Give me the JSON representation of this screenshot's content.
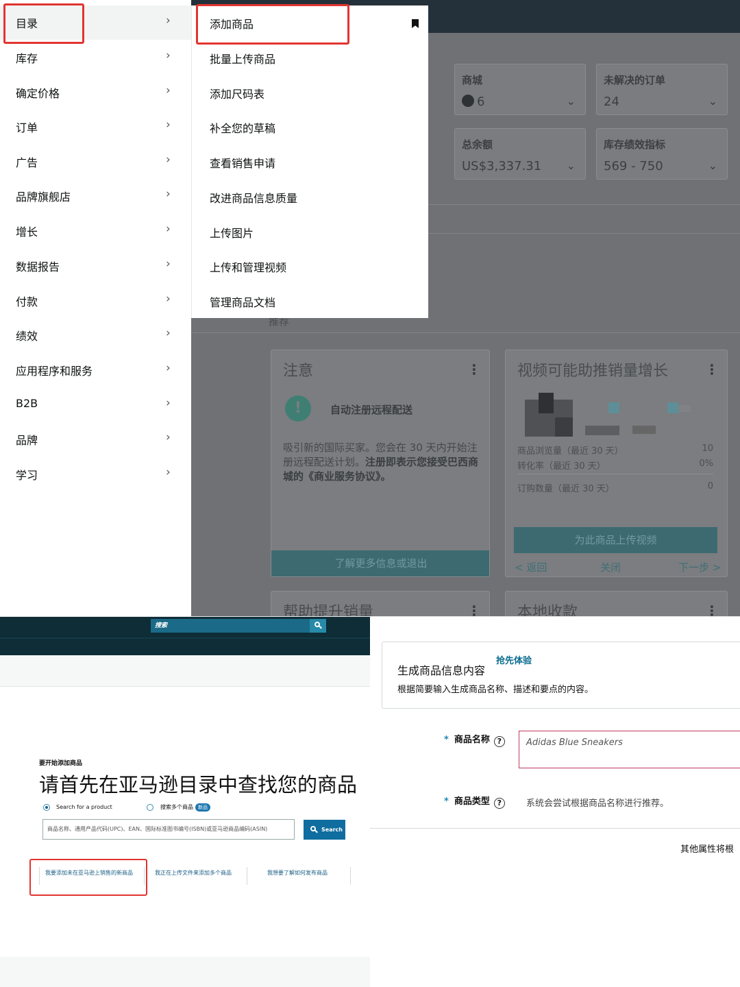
{
  "left_menu": {
    "items": [
      {
        "label": "目录"
      },
      {
        "label": "库存"
      },
      {
        "label": "确定价格"
      },
      {
        "label": "订单"
      },
      {
        "label": "广告"
      },
      {
        "label": "品牌旗舰店"
      },
      {
        "label": "增长"
      },
      {
        "label": "数据报告"
      },
      {
        "label": "付款"
      },
      {
        "label": "绩效"
      },
      {
        "label": "应用程序和服务"
      },
      {
        "label": "B2B"
      },
      {
        "label": "品牌"
      },
      {
        "label": "学习"
      }
    ]
  },
  "sub_menu": {
    "items": [
      {
        "label": "添加商品"
      },
      {
        "label": "批量上传商品"
      },
      {
        "label": "添加尺码表"
      },
      {
        "label": "补全您的草稿"
      },
      {
        "label": "查看销售申请"
      },
      {
        "label": "改进商品信息质量"
      },
      {
        "label": "上传图片"
      },
      {
        "label": "上传和管理视频"
      },
      {
        "label": "管理商品文档"
      }
    ]
  },
  "dashboard": {
    "metrics": [
      {
        "label": "商城",
        "value": "6"
      },
      {
        "label": "未解决的订单",
        "value": "24"
      },
      {
        "label": "总余额",
        "value": "US$3,337.31"
      },
      {
        "label": "库存绩效指标",
        "value": "569 - 750"
      }
    ],
    "section_label": "推荐",
    "notice_card": {
      "title": "注意",
      "heading": "自动注册远程配送",
      "body_1": "吸引新的国际买家。您会在 30 天内开始注册远程配送计划。",
      "body_bold": "注册即表示您接受巴西商城的《商业服务协议》。",
      "button": "了解更多信息或退出"
    },
    "video_card": {
      "title": "视频可能助推销量增长",
      "rows": [
        {
          "label": "商品浏览量（最近 30 天）",
          "value": "10"
        },
        {
          "label": "转化率（最近 30 天）",
          "value": "0%"
        },
        {
          "label": "订购数量（最近 30 天）",
          "value": "0"
        }
      ],
      "button": "为此商品上传视频",
      "nav_back": "< 返回",
      "nav_close": "关闭",
      "nav_next": "下一步 >"
    },
    "bottom_cards": [
      {
        "title": "帮助提升销量"
      },
      {
        "title": "本地收款"
      }
    ]
  },
  "add_product": {
    "search_placeholder": "搜索",
    "kicker": "要开始添加商品",
    "title": "请首先在亚马逊目录中查找您的商品",
    "radio_single": "Search for a product",
    "radio_multi": "搜索多个商品",
    "new_badge": "新品",
    "input_placeholder": "商品名称、通用产品代码(UPC)、EAN、国际标准图书编号(ISBN)或亚马逊商品编码(ASIN)",
    "search_button": "Search",
    "links": [
      {
        "label": "我要添加未在亚马逊上销售的新商品"
      },
      {
        "label": "我正在上传文件来添加多个商品"
      },
      {
        "label": "我想要了解如何发布商品"
      }
    ]
  },
  "generate_listing": {
    "banner_title": "生成商品信息内容",
    "banner_badge": "抢先体验",
    "banner_desc": "根据简要输入生成商品名称、描述和要点的内容。",
    "name_label": "商品名称",
    "name_value": "Adidas Blue Sneakers",
    "type_label": "商品类型",
    "type_hint": "系统会尝试根据商品名称进行推荐。",
    "more_text": "其他属性将根"
  },
  "colors": {
    "highlight_red": "#e2342f",
    "nav_dark": "#0e2d37",
    "link_blue": "#1b5f85",
    "focus_border": "#c03a5c"
  }
}
